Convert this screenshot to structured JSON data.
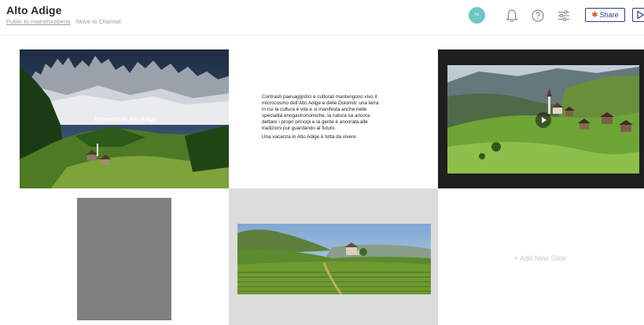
{
  "header": {
    "title": "Alto Adige",
    "public_link": "Public to maestroroberto",
    "move_link": "Move to Channel",
    "avatar_initials": "rs",
    "share_label": "Share"
  },
  "icons": {
    "notifications": "bell-icon",
    "help": "question-circle-icon",
    "settings": "sliders-icon",
    "share": "slack-logo-icon",
    "present": "play-icon",
    "video_play": "play-circle-icon"
  },
  "slides": {
    "s1": {
      "caption": "Benvenuti in Alto Adige"
    },
    "s2": {
      "lines": [
        "Contrasti paesaggistici e culturali mantengono vivo il",
        "microcosmo dell'Alto Adige e delle Dolomiti: una terra",
        "in cui la cultura è vita e si manifesta anche nelle",
        "specialità enogastronomiche, la natura sa ancora",
        "dettare i propri principi e la gente è ancorata alle",
        "tradizioni pur guardando al futuro."
      ],
      "line2": "Una vacanza in Alto Adige è tutta da vivere"
    },
    "add_new": "+ Add New Slide"
  },
  "colors": {
    "accent": "#2f3b8f",
    "avatar": "#6fc7c1",
    "slide3_bg": "#1f1f1f",
    "slide5_bg": "#dcdcdc",
    "slide4_placeholder": "#808080"
  }
}
